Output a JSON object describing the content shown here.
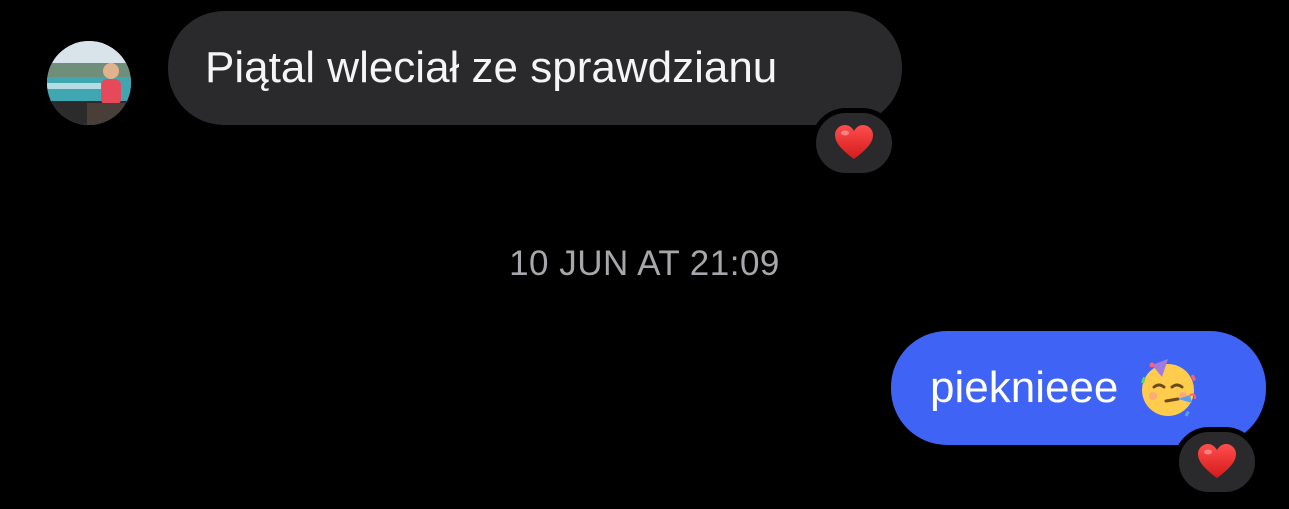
{
  "conversation": {
    "messages": [
      {
        "direction": "incoming",
        "text": "Piątal wleciał ze sprawdzianu",
        "reaction_icon": "red-heart-emoji"
      },
      {
        "direction": "outgoing",
        "text": "pieknieee",
        "emoji_icon": "partying-face-emoji",
        "reaction_icon": "red-heart-emoji"
      }
    ],
    "timestamp": "10 JUN AT 21:09"
  },
  "colors": {
    "background": "#000000",
    "incoming_bubble": "#2a2a2c",
    "outgoing_bubble": "#3f63f5",
    "timestamp_text": "#a7a7ab"
  }
}
